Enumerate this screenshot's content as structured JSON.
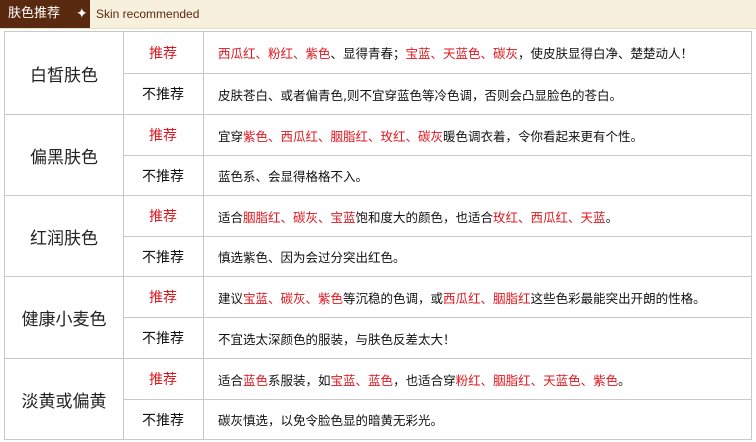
{
  "header": {
    "tab_title": "肤色推荐",
    "star": "✦",
    "subtitle": "Skin recommended"
  },
  "rows": [
    {
      "skin": "白皙肤色",
      "rec_label": "推荐",
      "rec_parts": [
        {
          "t": "西瓜红、粉红、紫色",
          "red": true
        },
        {
          "t": "、显得青春；",
          "red": false
        },
        {
          "t": "宝蓝、天蓝色、碳灰",
          "red": true
        },
        {
          "t": "，使皮肤显得白净、楚楚动人！",
          "red": false
        }
      ],
      "notrec_label": "不推荐",
      "notrec_parts": [
        {
          "t": "皮肤苍白、或者偏青色,则不宜穿蓝色等冷色调，否则会凸显脸色的苍白。",
          "red": false
        }
      ]
    },
    {
      "skin": "偏黑肤色",
      "rec_label": "推荐",
      "rec_parts": [
        {
          "t": "宜穿",
          "red": false
        },
        {
          "t": "紫色、西瓜红、胭脂红、玫红、碳灰",
          "red": true
        },
        {
          "t": "暖色调衣着，令你看起来更有个性。",
          "red": false
        }
      ],
      "notrec_label": "不推荐",
      "notrec_parts": [
        {
          "t": "蓝色系、会显得格格不入。",
          "red": false
        }
      ]
    },
    {
      "skin": "红润肤色",
      "rec_label": "推荐",
      "rec_parts": [
        {
          "t": "适合",
          "red": false
        },
        {
          "t": "胭脂红、碳灰、宝蓝",
          "red": true
        },
        {
          "t": "饱和度大的颜色，也适合",
          "red": false
        },
        {
          "t": "玫红、西瓜红、天蓝",
          "red": true
        },
        {
          "t": "。",
          "red": false
        }
      ],
      "notrec_label": "不推荐",
      "notrec_parts": [
        {
          "t": "慎选紫色、因为会过分突出红色。",
          "red": false
        }
      ]
    },
    {
      "skin": "健康小麦色",
      "rec_label": "推荐",
      "rec_parts": [
        {
          "t": "建议",
          "red": false
        },
        {
          "t": "宝蓝、碳灰、紫色",
          "red": true
        },
        {
          "t": "等沉稳的色调，或",
          "red": false
        },
        {
          "t": "西瓜红、胭脂红",
          "red": true
        },
        {
          "t": "这些色彩最能突出开朗的性格。",
          "red": false
        }
      ],
      "notrec_label": "不推荐",
      "notrec_parts": [
        {
          "t": "不宜选太深颜色的服装，与肤色反差太大！",
          "red": false
        }
      ]
    },
    {
      "skin": "淡黄或偏黄",
      "rec_label": "推荐",
      "rec_parts": [
        {
          "t": "适合",
          "red": false
        },
        {
          "t": "蓝色",
          "red": true
        },
        {
          "t": "系服装，如",
          "red": false
        },
        {
          "t": "宝蓝、蓝色",
          "red": true
        },
        {
          "t": "，也适合穿",
          "red": false
        },
        {
          "t": "粉红、胭脂红、天蓝色、紫色",
          "red": true
        },
        {
          "t": "。",
          "red": false
        }
      ],
      "notrec_label": "不推荐",
      "notrec_parts": [
        {
          "t": "碳灰慎选，以免令脸色显的暗黄无彩光。",
          "red": false
        }
      ]
    }
  ]
}
